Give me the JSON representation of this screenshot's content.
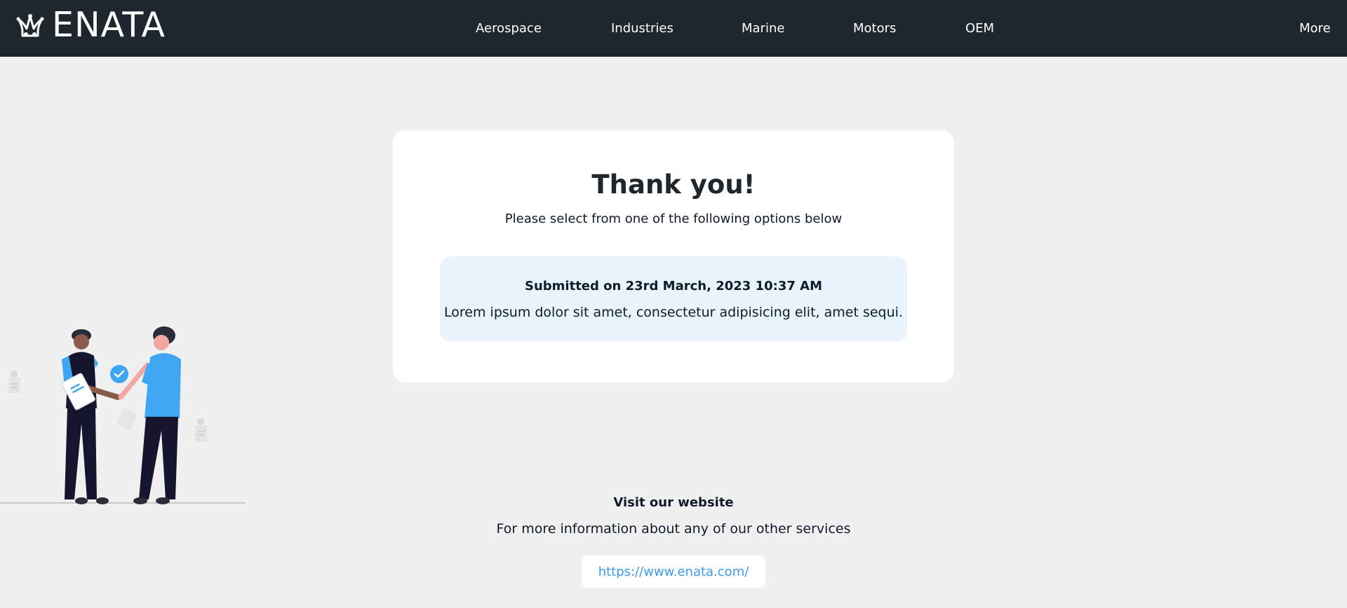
{
  "header": {
    "logo_text": "ENATA",
    "nav": [
      {
        "label": "Aerospace"
      },
      {
        "label": "Industries"
      },
      {
        "label": "Marine"
      },
      {
        "label": "Motors"
      },
      {
        "label": "OEM"
      },
      {
        "label": "More"
      }
    ]
  },
  "card": {
    "title": "Thank you!",
    "subtitle": "Please select from one of the following options below",
    "info": {
      "title": "Submitted on 23rd March, 2023 10:37 AM",
      "text": "Lorem ipsum dolor sit amet, consectetur adipisicing elit, amet sequi."
    }
  },
  "footer": {
    "title": "Visit our website",
    "text": "For more information about any of our other services",
    "link": "https://www.enata.com/"
  },
  "colors": {
    "header_bg": "#1e262e",
    "page_bg": "#f0f0f0",
    "info_bg": "#e8f3fc",
    "link": "#3c9be8",
    "accent_blue": "#3ea6f5"
  },
  "icons": [
    "enata-logo-icon",
    "check-icon",
    "handshake-illustration"
  ]
}
